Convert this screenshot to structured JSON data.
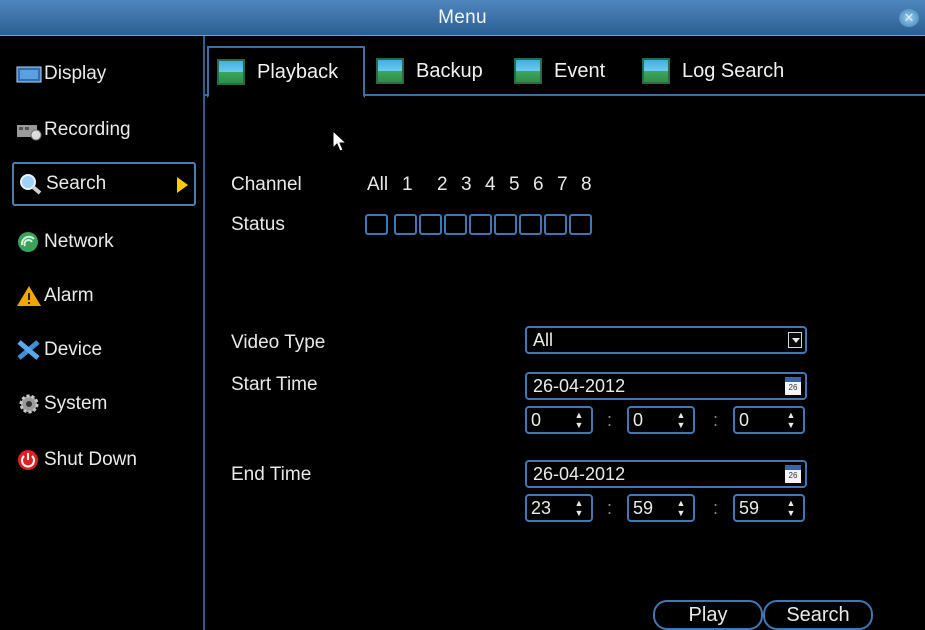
{
  "window": {
    "title": "Menu",
    "close_icon": "close-icon"
  },
  "sidebar": {
    "items": [
      {
        "label": "Display",
        "icon": "display-icon",
        "active": false
      },
      {
        "label": "Recording",
        "icon": "recording-icon",
        "active": false
      },
      {
        "label": "Search",
        "icon": "search-icon",
        "active": true
      },
      {
        "label": "Network",
        "icon": "network-icon",
        "active": false
      },
      {
        "label": "Alarm",
        "icon": "alarm-icon",
        "active": false
      },
      {
        "label": "Device",
        "icon": "device-icon",
        "active": false
      },
      {
        "label": "System",
        "icon": "system-icon",
        "active": false
      },
      {
        "label": "Shut Down",
        "icon": "power-icon",
        "active": false
      }
    ]
  },
  "tabs": [
    {
      "label": "Playback",
      "active": true
    },
    {
      "label": "Backup",
      "active": false
    },
    {
      "label": "Event",
      "active": false
    },
    {
      "label": "Log Search",
      "active": false
    }
  ],
  "search": {
    "channel_label": "Channel",
    "status_label": "Status",
    "channels": [
      "All",
      "1",
      "2",
      "3",
      "4",
      "5",
      "6",
      "7",
      "8"
    ],
    "video_type_label": "Video Type",
    "video_type_value": "All",
    "start_time_label": "Start Time",
    "start_date": "26-04-2012",
    "start_hour": "0",
    "start_minute": "0",
    "start_second": "0",
    "end_time_label": "End Time",
    "end_date": "26-04-2012",
    "end_hour": "23",
    "end_minute": "59",
    "end_second": "59",
    "time_separator": ":",
    "calendar_day": "26"
  },
  "buttons": {
    "play": "Play",
    "search": "Search"
  },
  "colors": {
    "accent": "#3f78b4",
    "titlebar": "#2b5f93",
    "arrow": "#ffcc00"
  }
}
